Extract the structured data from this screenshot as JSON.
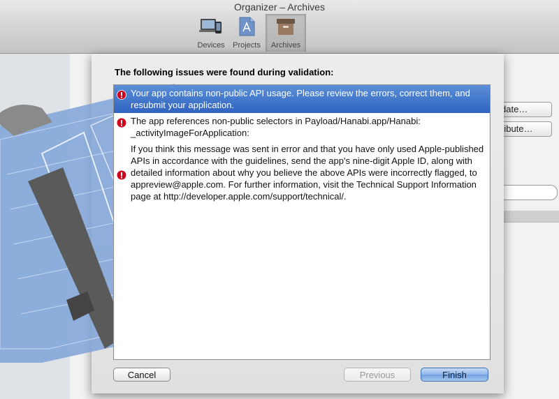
{
  "window": {
    "title": "Organizer – Archives"
  },
  "toolbar": {
    "items": [
      {
        "label": "Devices",
        "icon": "devices-icon"
      },
      {
        "label": "Projects",
        "icon": "projects-icon"
      },
      {
        "label": "Archives",
        "icon": "archives-icon",
        "selected": true
      }
    ]
  },
  "background": {
    "validate_label": "date…",
    "distribute_label": "ribute…"
  },
  "sheet": {
    "heading": "The following issues were found during validation:",
    "issues": [
      {
        "icon": "error-icon",
        "lines": [
          "Your app contains non-public API usage. Please review the errors, correct them, and resubmit your application."
        ],
        "selected": true
      },
      {
        "icon": "error-icon",
        "lines": [
          "The app references non-public selectors in Payload/Hanabi.app/Hanabi: _activityImageForApplication:"
        ]
      },
      {
        "icon": "error-icon",
        "lines": [
          "If you think this message was sent in error and that you have only used Apple-published APIs in accordance with the guidelines, send the app's nine-digit Apple ID, along with detailed information about why you believe the above APIs were incorrectly flagged, to appreview@apple.com. For further information, visit the Technical Support Information page at http://developer.apple.com/support/technical/."
        ]
      }
    ],
    "buttons": {
      "cancel": "Cancel",
      "previous": "Previous",
      "finish": "Finish"
    }
  },
  "colors": {
    "selection": "#2f63bf",
    "error": "#d0021b",
    "default_button": "#6f9fe0"
  }
}
